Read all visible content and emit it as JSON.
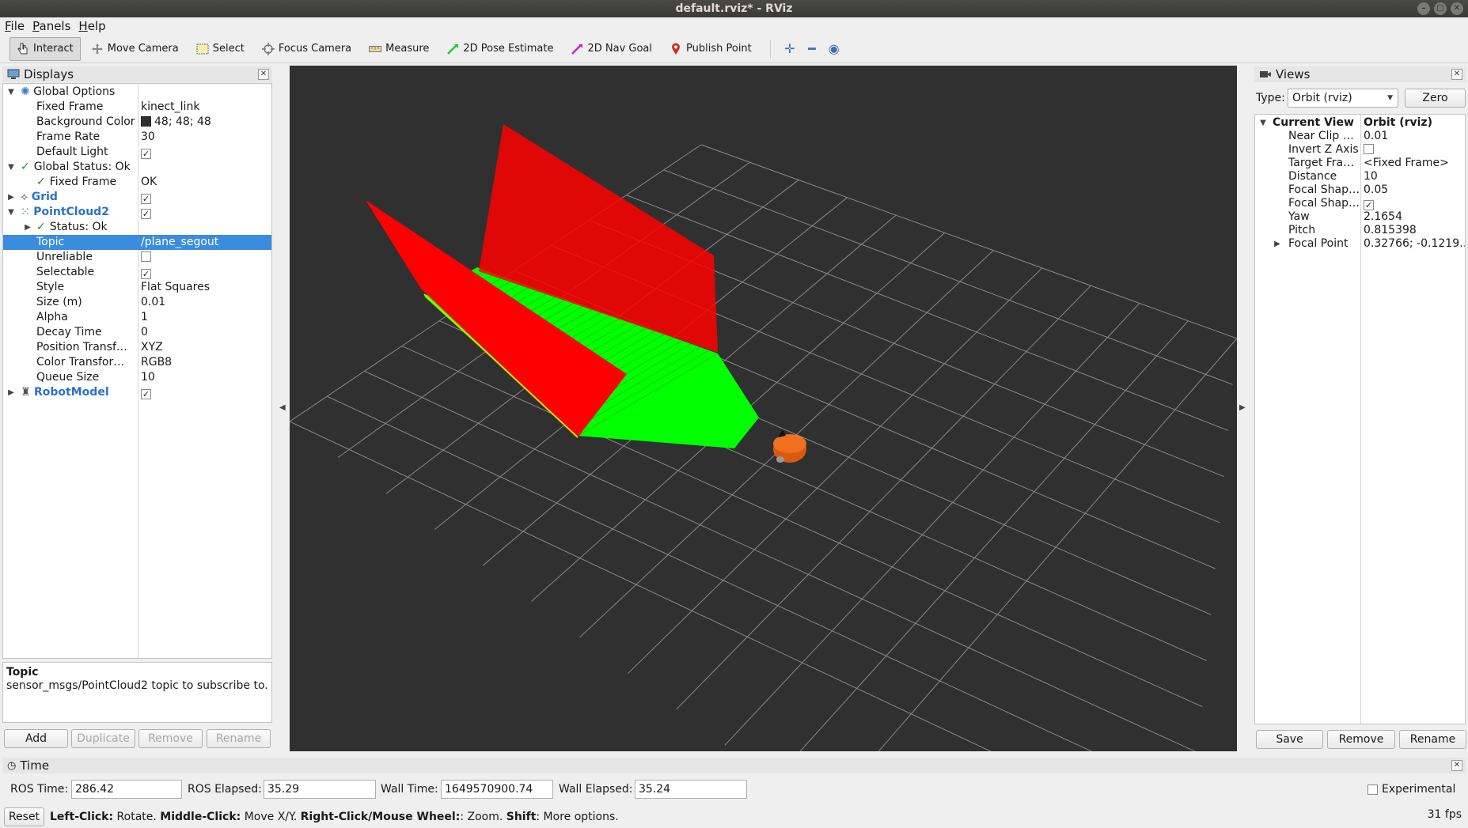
{
  "window": {
    "title": "default.rviz* - RViz"
  },
  "menu": [
    "File",
    "Panels",
    "Help"
  ],
  "toolbar": {
    "tools": [
      {
        "label": "Interact",
        "icon": "interact-icon"
      },
      {
        "label": "Move Camera",
        "icon": "move-camera-icon"
      },
      {
        "label": "Select",
        "icon": "select-icon"
      },
      {
        "label": "Focus Camera",
        "icon": "focus-camera-icon"
      },
      {
        "label": "Measure",
        "icon": "measure-icon"
      },
      {
        "label": "2D Pose Estimate",
        "icon": "pose-estimate-icon"
      },
      {
        "label": "2D Nav Goal",
        "icon": "nav-goal-icon"
      },
      {
        "label": "Publish Point",
        "icon": "publish-point-icon"
      }
    ]
  },
  "displays": {
    "title": "Displays",
    "rows": [
      {
        "name": "Global Options",
        "value": ""
      },
      {
        "name": "Fixed Frame",
        "value": "kinect_link"
      },
      {
        "name": "Background Color",
        "value": "48; 48; 48"
      },
      {
        "name": "Frame Rate",
        "value": "30"
      },
      {
        "name": "Default Light",
        "value": ""
      },
      {
        "name": "Global Status: Ok",
        "value": ""
      },
      {
        "name": "Fixed Frame",
        "value": "OK"
      },
      {
        "name": "Grid",
        "value": ""
      },
      {
        "name": "PointCloud2",
        "value": ""
      },
      {
        "name": "Status: Ok",
        "value": ""
      },
      {
        "name": "Topic",
        "value": "/plane_segout"
      },
      {
        "name": "Unreliable",
        "value": ""
      },
      {
        "name": "Selectable",
        "value": ""
      },
      {
        "name": "Style",
        "value": "Flat Squares"
      },
      {
        "name": "Size (m)",
        "value": "0.01"
      },
      {
        "name": "Alpha",
        "value": "1"
      },
      {
        "name": "Decay Time",
        "value": "0"
      },
      {
        "name": "Position Transf…",
        "value": "XYZ"
      },
      {
        "name": "Color Transfor…",
        "value": "RGB8"
      },
      {
        "name": "Queue Size",
        "value": "10"
      },
      {
        "name": "RobotModel",
        "value": ""
      }
    ],
    "description_title": "Topic",
    "description_text": "sensor_msgs/PointCloud2 topic to subscribe to.",
    "buttons": [
      "Add",
      "Duplicate",
      "Remove",
      "Rename"
    ]
  },
  "views": {
    "title": "Views",
    "type_label": "Type:",
    "type_value": "Orbit (rviz)",
    "zero_label": "Zero",
    "rows": [
      {
        "name": "Current View",
        "value": "Orbit (rviz)"
      },
      {
        "name": "Near Clip …",
        "value": "0.01"
      },
      {
        "name": "Invert Z Axis",
        "value": ""
      },
      {
        "name": "Target Fra…",
        "value": "<Fixed Frame>"
      },
      {
        "name": "Distance",
        "value": "10"
      },
      {
        "name": "Focal Shap…",
        "value": "0.05"
      },
      {
        "name": "Focal Shap…",
        "value": ""
      },
      {
        "name": "Yaw",
        "value": "2.1654"
      },
      {
        "name": "Pitch",
        "value": "0.815398"
      },
      {
        "name": "Focal Point",
        "value": "0.32766; -0.1219…"
      }
    ],
    "buttons": [
      "Save",
      "Remove",
      "Rename"
    ]
  },
  "time": {
    "title": "Time",
    "ros_time_label": "ROS Time:",
    "ros_time": "286.42",
    "ros_elapsed_label": "ROS Elapsed:",
    "ros_elapsed": "35.29",
    "wall_time_label": "Wall Time:",
    "wall_time": "1649570900.74",
    "wall_elapsed_label": "Wall Elapsed:",
    "wall_elapsed": "35.24",
    "experimental_label": "Experimental"
  },
  "status": {
    "reset_label": "Reset",
    "hint_bold_1": "Left-Click:",
    "hint_1": " Rotate. ",
    "hint_bold_2": "Middle-Click:",
    "hint_2": " Move X/Y. ",
    "hint_bold_3": "Right-Click/Mouse Wheel:",
    "hint_3": ": Zoom. ",
    "hint_bold_4": "Shift",
    "hint_4": ": More options.",
    "fps": "31 fps"
  },
  "colors": {
    "viewport_bg": "#303030",
    "grid": "#8a8a8a",
    "plane_red": "#ff0000",
    "plane_green": "#00ff00",
    "selection": "#3a8dde",
    "robot": "#e06010"
  }
}
